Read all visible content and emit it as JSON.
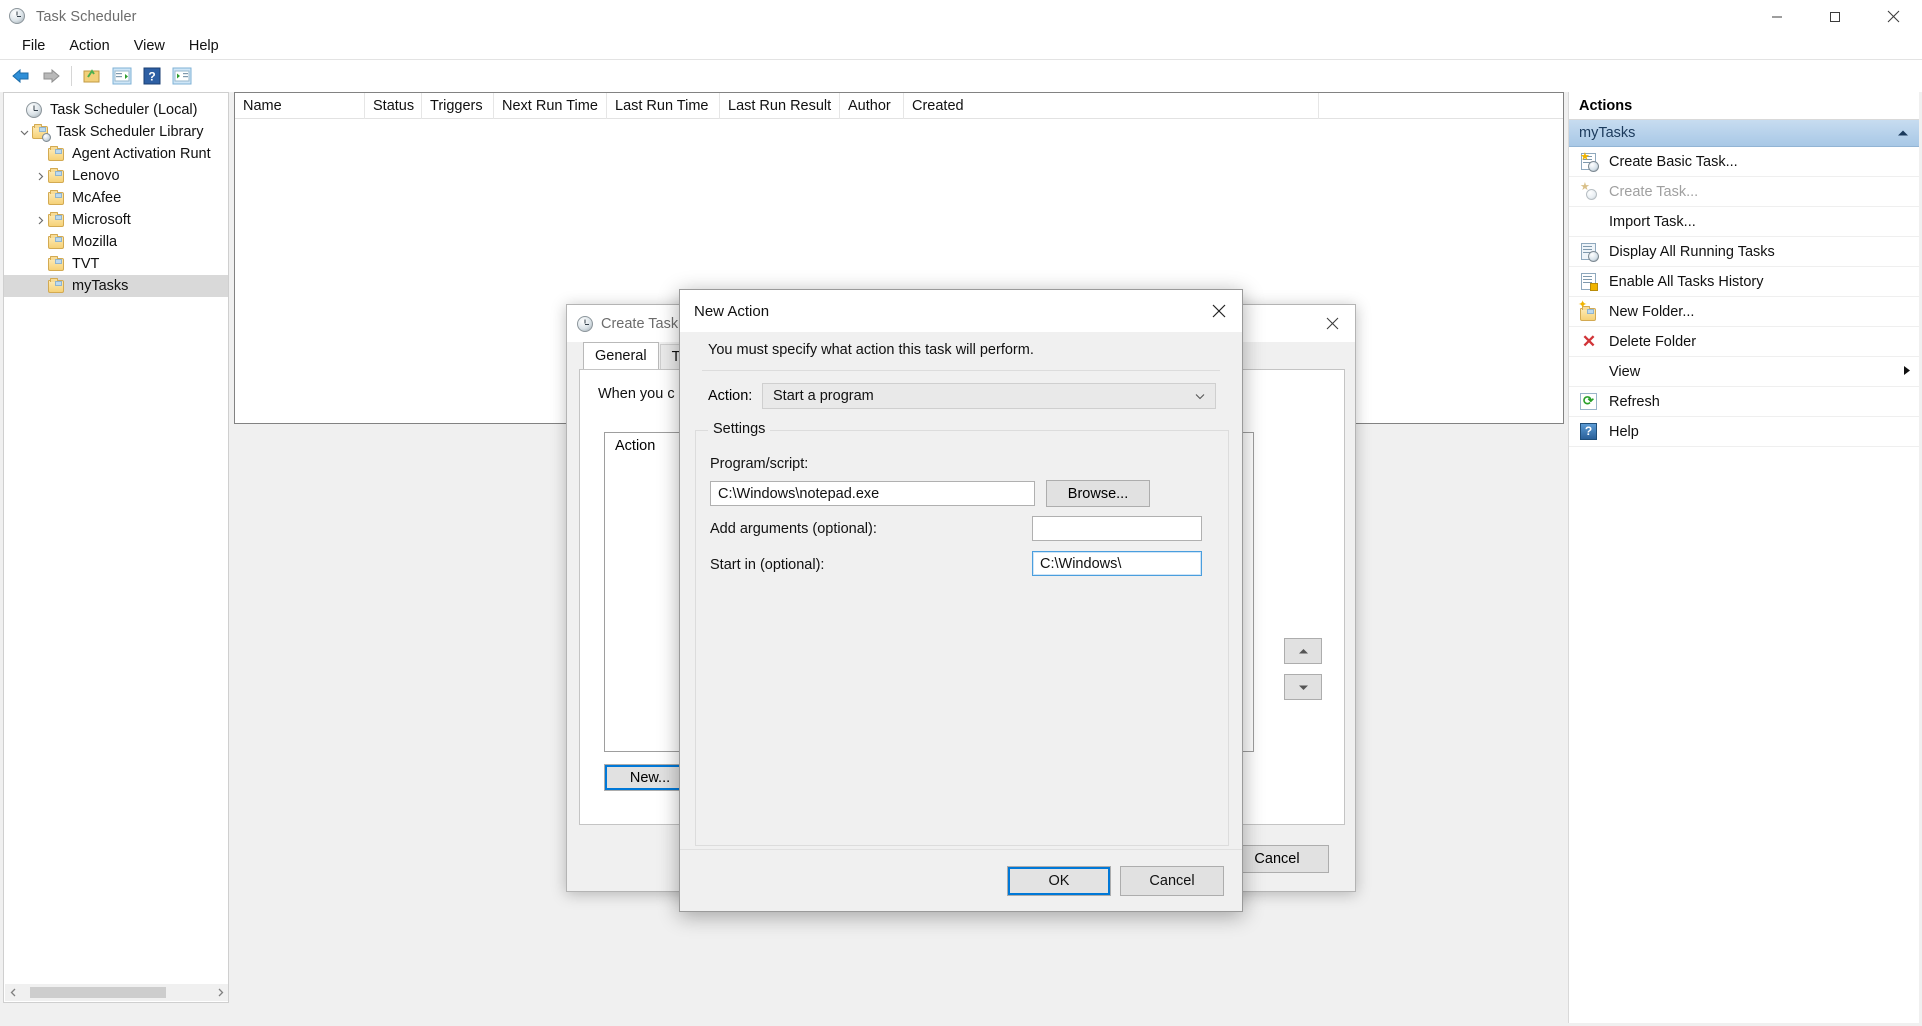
{
  "window": {
    "title": "Task Scheduler",
    "icon": "clock-icon",
    "controls": {
      "minimize": "minimize-icon",
      "maximize": "maximize-icon",
      "close": "close-icon"
    }
  },
  "menubar": {
    "items": [
      "File",
      "Action",
      "View",
      "Help"
    ]
  },
  "toolbar": {
    "items": [
      {
        "name": "back-button",
        "icon": "arrow-left-icon"
      },
      {
        "name": "forward-button",
        "icon": "arrow-right-icon"
      },
      {
        "name": "show-hide-console-tree-button",
        "icon": "folder-tree-icon"
      },
      {
        "name": "properties-button",
        "icon": "properties-icon"
      },
      {
        "name": "help-button",
        "icon": "question-mark-icon"
      },
      {
        "name": "show-hide-action-pane-button",
        "icon": "action-pane-icon"
      }
    ]
  },
  "tree": {
    "nodes": [
      {
        "label": "Task Scheduler (Local)",
        "indent": 0,
        "twisty": "none",
        "icon": "clock-icon",
        "selected": false
      },
      {
        "label": "Task Scheduler Library",
        "indent": 1,
        "twisty": "expanded",
        "icon": "library-folder-icon",
        "selected": false
      },
      {
        "label": "Agent Activation Runt",
        "indent": 2,
        "twisty": "none",
        "icon": "folder-icon",
        "selected": false
      },
      {
        "label": "Lenovo",
        "indent": 2,
        "twisty": "collapsed",
        "icon": "folder-icon",
        "selected": false
      },
      {
        "label": "McAfee",
        "indent": 2,
        "twisty": "none",
        "icon": "folder-icon",
        "selected": false
      },
      {
        "label": "Microsoft",
        "indent": 2,
        "twisty": "collapsed",
        "icon": "folder-icon",
        "selected": false
      },
      {
        "label": "Mozilla",
        "indent": 2,
        "twisty": "none",
        "icon": "folder-icon",
        "selected": false
      },
      {
        "label": "TVT",
        "indent": 2,
        "twisty": "none",
        "icon": "folder-icon",
        "selected": false
      },
      {
        "label": "myTasks",
        "indent": 2,
        "twisty": "none",
        "icon": "folder-icon",
        "selected": true
      }
    ]
  },
  "list": {
    "columns": [
      "Name",
      "Status",
      "Triggers",
      "Next Run Time",
      "Last Run Time",
      "Last Run Result",
      "Author",
      "Created"
    ],
    "rows": []
  },
  "actions_pane": {
    "title": "Actions",
    "group_label": "myTasks",
    "collapse_icon": "chevron-up-icon",
    "items": [
      {
        "label": "Create Basic Task...",
        "icon": "create-basic-task-icon",
        "disabled": false,
        "submenu": false
      },
      {
        "label": "Create Task...",
        "icon": "create-task-icon",
        "disabled": true,
        "submenu": false
      },
      {
        "label": "Import Task...",
        "icon": "none",
        "disabled": false,
        "submenu": false
      },
      {
        "label": "Display All Running Tasks",
        "icon": "running-tasks-icon",
        "disabled": false,
        "submenu": false
      },
      {
        "label": "Enable All Tasks History",
        "icon": "history-icon",
        "disabled": false,
        "submenu": false
      },
      {
        "label": "New Folder...",
        "icon": "new-folder-icon",
        "disabled": false,
        "submenu": false
      },
      {
        "label": "Delete Folder",
        "icon": "delete-x-icon",
        "disabled": false,
        "submenu": false
      },
      {
        "label": "View",
        "icon": "none",
        "disabled": false,
        "submenu": true
      },
      {
        "label": "Refresh",
        "icon": "refresh-icon",
        "disabled": false,
        "submenu": false
      },
      {
        "label": "Help",
        "icon": "help-icon",
        "disabled": false,
        "submenu": false
      }
    ]
  },
  "create_task_dialog": {
    "title": "Create Task",
    "icon": "clock-icon",
    "close_icon": "close-icon",
    "tabs": [
      {
        "label": "General",
        "active": true
      },
      {
        "label": "Trig",
        "active": false
      }
    ],
    "description": "When you c",
    "listbox_header": "Action",
    "new_button": "New...",
    "move_up_icon": "chevron-up-icon",
    "move_down_icon": "chevron-down-icon",
    "cancel_button": "Cancel"
  },
  "new_action_dialog": {
    "title": "New Action",
    "close_icon": "close-icon",
    "instruction": "You must specify what action this task will perform.",
    "action_label": "Action:",
    "action_value": "Start a program",
    "action_chevron": "chevron-down-icon",
    "settings_legend": "Settings",
    "program_label": "Program/script:",
    "program_value": "C:\\Windows\\notepad.exe",
    "browse_button": "Browse...",
    "arguments_label": "Add arguments (optional):",
    "arguments_value": "",
    "startin_label": "Start in (optional):",
    "startin_value": "C:\\Windows\\",
    "ok_button": "OK",
    "cancel_button": "Cancel",
    "focus_color": "#0078d7"
  }
}
